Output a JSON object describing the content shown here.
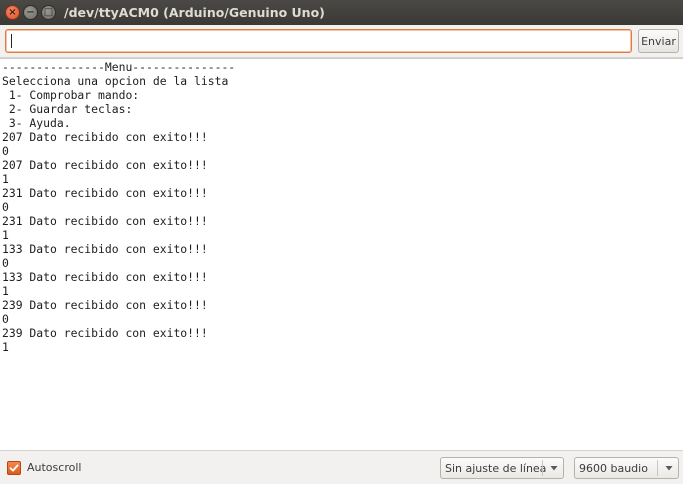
{
  "window": {
    "title": "/dev/ttyACM0 (Arduino/Genuino Uno)",
    "close_glyph": "×",
    "minimize_glyph": "−",
    "maximize_glyph": "□"
  },
  "toolbar": {
    "input_value": "",
    "send_label": "Enviar"
  },
  "console": {
    "lines": [
      "---------------Menu---------------",
      "Selecciona una opcion de la lista",
      " 1- Comprobar mando:",
      " 2- Guardar teclas:",
      " 3- Ayuda.",
      "207 Dato recibido con exito!!!",
      "0",
      "207 Dato recibido con exito!!!",
      "1",
      "231 Dato recibido con exito!!!",
      "0",
      "231 Dato recibido con exito!!!",
      "1",
      "133 Dato recibido con exito!!!",
      "0",
      "133 Dato recibido con exito!!!",
      "1",
      "239 Dato recibido con exito!!!",
      "0",
      "239 Dato recibido con exito!!!",
      "1"
    ]
  },
  "statusbar": {
    "autoscroll_label": "Autoscroll",
    "autoscroll_checked": true,
    "line_ending_value": "Sin ajuste de línea",
    "baud_value": "9600 baudio"
  },
  "colors": {
    "accent": "#dd5a1c",
    "titlebar": "#3c3b37",
    "console_bg": "#ffffff"
  }
}
